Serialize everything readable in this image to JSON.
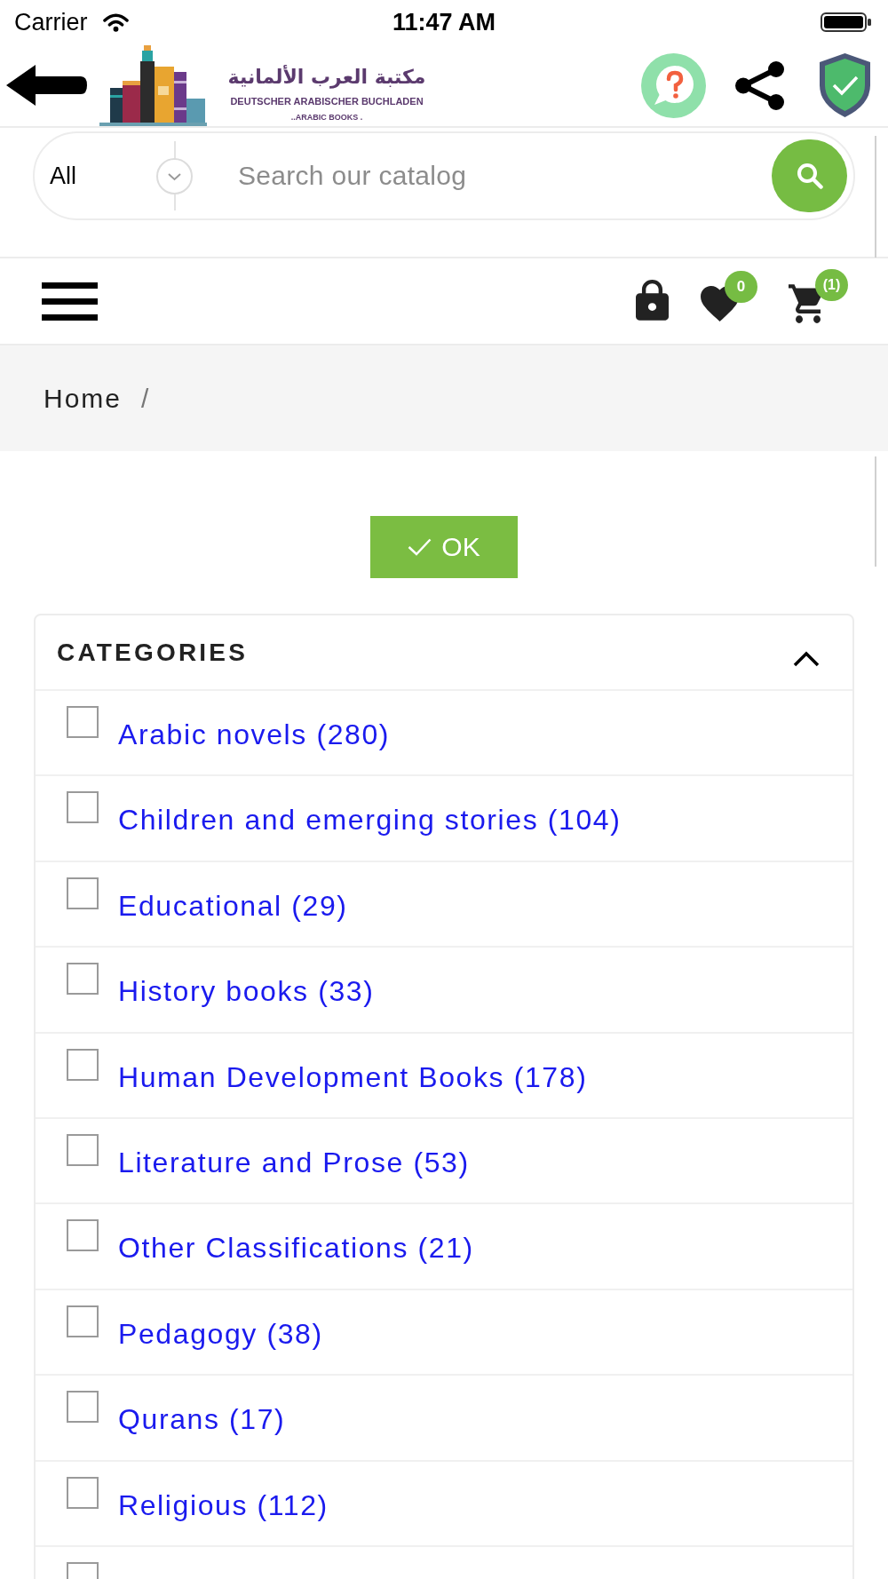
{
  "status_bar": {
    "carrier": "Carrier",
    "time": "11:47 AM"
  },
  "header": {
    "logo": {
      "arabic_name": "مكتبة العرب الألمانية",
      "german_name": "DEUTSCHER ARABISCHER BUCHLADEN",
      "tagline": "..ARABIC BOOKS ."
    }
  },
  "search": {
    "category": "All",
    "placeholder": "Search our catalog"
  },
  "nav": {
    "wishlist_count": "0",
    "cart_count": "(1)"
  },
  "breadcrumb": {
    "items": [
      {
        "label": "Home"
      }
    ],
    "separator": "/"
  },
  "ok_button": {
    "label": "OK"
  },
  "categories": {
    "title": "CATEGORIES",
    "expanded": true,
    "items": [
      {
        "label": "Arabic novels (280)",
        "checked": false
      },
      {
        "label": "Children and emerging stories (104)",
        "checked": false
      },
      {
        "label": "Educational (29)",
        "checked": false
      },
      {
        "label": "History books (33)",
        "checked": false
      },
      {
        "label": "Human Development Books (178)",
        "checked": false
      },
      {
        "label": "Literature and Prose (53)",
        "checked": false
      },
      {
        "label": "Other Classifications (21)",
        "checked": false
      },
      {
        "label": "Pedagogy (38)",
        "checked": false
      },
      {
        "label": "Qurans (17)",
        "checked": false
      },
      {
        "label": "Religious (112)",
        "checked": false
      },
      {
        "checked": false
      }
    ]
  }
}
